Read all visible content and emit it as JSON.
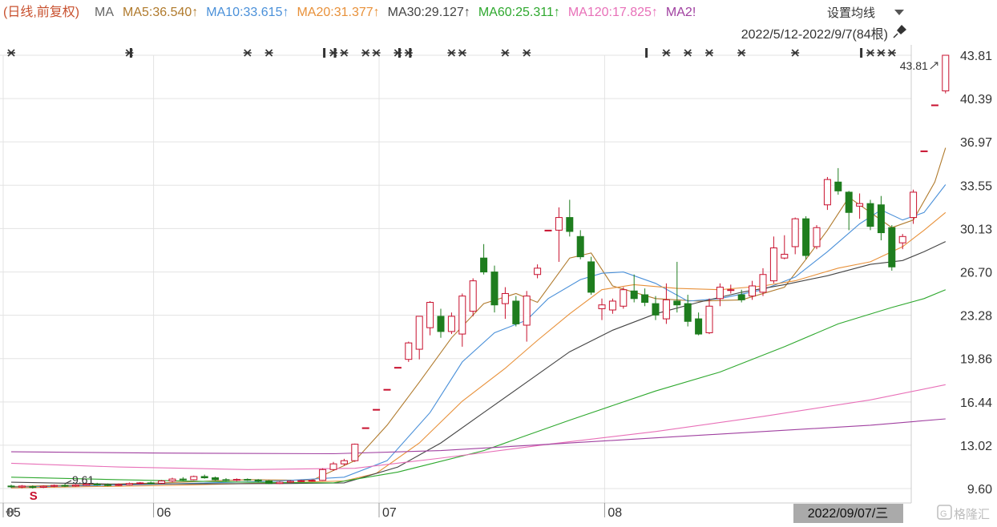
{
  "header": {
    "prefix": "(日线,前复权)",
    "ma_label": "MA",
    "ma_items": [
      {
        "label": "MA5:36.540↑",
        "color": "#b07a2c"
      },
      {
        "label": "MA10:33.615↑",
        "color": "#4a90d9"
      },
      {
        "label": "MA20:31.377↑",
        "color": "#e8913a"
      },
      {
        "label": "MA30:29.127↑",
        "color": "#444444"
      },
      {
        "label": "MA60:25.311↑",
        "color": "#2ea82e"
      },
      {
        "label": "MA120:17.825↑",
        "color": "#e870b8"
      },
      {
        "label": "MA2!",
        "color": "#a040a0"
      }
    ],
    "settings_label": "设置均线",
    "range_label": "2022/5/12-2022/9/7(84根)"
  },
  "footer": {
    "current_date": "2022/09/07/三",
    "watermark": "格隆汇"
  },
  "chart_data": {
    "type": "candlestick",
    "y_ticks": [
      "43.81",
      "40.39",
      "36.97",
      "33.55",
      "30.13",
      "26.70",
      "23.28",
      "19.86",
      "16.44",
      "13.02",
      "9.60"
    ],
    "ylim": [
      9.6,
      43.81
    ],
    "x_ticks": [
      {
        "label": "05",
        "index": 0
      },
      {
        "label": "06",
        "index": 14
      },
      {
        "label": "07",
        "index": 35
      },
      {
        "label": "08",
        "index": 56
      }
    ],
    "annotations": {
      "high_label": "43.81",
      "low_label": "9.61",
      "s_marker": "S"
    },
    "colors": {
      "up": "#c8102e",
      "down": "#1e7d1e",
      "grid": "#e3e3e3"
    },
    "candles": [
      [
        9.8,
        9.75,
        9.9,
        9.65
      ],
      [
        9.72,
        9.8,
        9.88,
        9.62
      ],
      [
        9.75,
        9.7,
        9.85,
        9.6
      ],
      [
        9.7,
        9.78,
        9.86,
        9.64
      ],
      [
        9.78,
        9.85,
        9.92,
        9.7
      ],
      [
        9.85,
        9.8,
        9.96,
        9.72
      ],
      [
        9.8,
        9.88,
        9.95,
        9.74
      ],
      [
        9.86,
        9.95,
        10.05,
        9.8
      ],
      [
        9.95,
        9.9,
        10.05,
        9.82
      ],
      [
        9.9,
        9.85,
        10.0,
        9.78
      ],
      [
        9.85,
        9.92,
        10.0,
        9.8
      ],
      [
        9.9,
        10.0,
        10.08,
        9.85
      ],
      [
        10.0,
        10.05,
        10.12,
        9.92
      ],
      [
        10.05,
        10.02,
        10.15,
        9.95
      ],
      [
        10.02,
        10.2,
        10.28,
        9.98
      ],
      [
        10.2,
        10.35,
        10.45,
        10.12
      ],
      [
        10.35,
        10.3,
        10.5,
        10.22
      ],
      [
        10.3,
        10.55,
        10.62,
        10.25
      ],
      [
        10.55,
        10.45,
        10.7,
        10.38
      ],
      [
        10.45,
        10.3,
        10.55,
        10.22
      ],
      [
        10.3,
        10.25,
        10.42,
        10.18
      ],
      [
        10.25,
        10.32,
        10.4,
        10.18
      ],
      [
        10.32,
        10.28,
        10.4,
        10.2
      ],
      [
        10.28,
        10.2,
        10.35,
        10.1
      ],
      [
        10.2,
        10.0,
        10.26,
        9.95
      ],
      [
        10.0,
        10.1,
        10.18,
        9.95
      ],
      [
        10.1,
        10.18,
        10.25,
        10.05
      ],
      [
        10.18,
        10.22,
        10.3,
        10.12
      ],
      [
        10.22,
        10.25,
        10.32,
        10.15
      ],
      [
        10.25,
        11.1,
        11.2,
        10.22
      ],
      [
        11.1,
        11.55,
        11.7,
        11.0
      ],
      [
        11.55,
        11.8,
        11.95,
        11.4
      ],
      [
        11.8,
        13.1,
        13.15,
        11.7
      ],
      [
        14.4,
        14.4,
        14.4,
        14.4
      ],
      [
        15.85,
        15.85,
        15.85,
        15.85
      ],
      [
        17.43,
        17.43,
        17.43,
        17.43
      ],
      [
        19.17,
        19.17,
        19.17,
        19.17
      ],
      [
        19.8,
        21.1,
        21.2,
        19.6
      ],
      [
        20.6,
        23.2,
        23.2,
        19.8
      ],
      [
        22.3,
        24.3,
        24.4,
        21.7
      ],
      [
        23.2,
        22.0,
        23.8,
        21.5
      ],
      [
        22.0,
        23.2,
        23.5,
        21.8
      ],
      [
        21.8,
        24.8,
        25.0,
        20.8
      ],
      [
        23.6,
        26.0,
        26.2,
        23.2
      ],
      [
        27.8,
        26.7,
        28.9,
        26.5
      ],
      [
        26.7,
        24.1,
        27.2,
        23.5
      ],
      [
        24.2,
        25.0,
        25.5,
        23.0
      ],
      [
        24.4,
        22.6,
        24.8,
        22.4
      ],
      [
        22.5,
        24.8,
        25.2,
        21.2
      ],
      [
        26.5,
        27.0,
        27.3,
        26.2
      ],
      [
        30.0,
        30.0,
        30.0,
        30.0
      ],
      [
        30.0,
        31.0,
        31.8,
        27.5
      ],
      [
        31.0,
        29.9,
        32.4,
        29.5
      ],
      [
        29.5,
        27.9,
        30.0,
        27.7
      ],
      [
        27.5,
        25.1,
        27.9,
        24.9
      ],
      [
        23.8,
        24.1,
        24.6,
        22.9
      ],
      [
        23.7,
        24.4,
        24.6,
        23.4
      ],
      [
        24.0,
        25.3,
        25.5,
        23.8
      ],
      [
        25.2,
        24.6,
        26.5,
        24.3
      ],
      [
        24.9,
        24.3,
        25.4,
        24.0
      ],
      [
        24.2,
        23.3,
        24.8,
        22.9
      ],
      [
        23.0,
        24.5,
        25.8,
        22.6
      ],
      [
        24.4,
        24.1,
        27.5,
        23.5
      ],
      [
        24.2,
        22.8,
        24.9,
        22.4
      ],
      [
        23.0,
        21.8,
        23.5,
        21.7
      ],
      [
        21.9,
        24.0,
        24.6,
        21.8
      ],
      [
        24.6,
        25.5,
        25.8,
        24.0
      ],
      [
        25.3,
        25.3,
        25.7,
        25.0
      ],
      [
        24.9,
        24.5,
        25.3,
        24.3
      ],
      [
        24.8,
        25.6,
        26.0,
        24.5
      ],
      [
        25.1,
        26.5,
        27.0,
        24.8
      ],
      [
        26.0,
        28.6,
        29.5,
        25.8
      ],
      [
        27.8,
        28.1,
        29.6,
        27.7
      ],
      [
        28.7,
        30.9,
        31.0,
        28.1
      ],
      [
        30.9,
        28.0,
        31.1,
        27.7
      ],
      [
        28.7,
        30.2,
        30.4,
        28.5
      ],
      [
        32.0,
        34.0,
        34.2,
        31.6
      ],
      [
        33.8,
        33.1,
        34.9,
        32.8
      ],
      [
        33.0,
        31.4,
        33.1,
        30.0
      ],
      [
        31.9,
        32.1,
        32.9,
        30.9
      ],
      [
        32.1,
        30.3,
        32.4,
        30.0
      ],
      [
        32.0,
        29.8,
        32.7,
        29.2
      ],
      [
        30.2,
        27.1,
        30.4,
        26.8
      ],
      [
        29.0,
        29.5,
        29.7,
        28.5
      ],
      [
        31.0,
        33.0,
        33.2,
        30.5
      ],
      [
        36.26,
        36.26,
        36.26,
        36.26
      ],
      [
        39.89,
        39.89,
        39.89,
        39.89
      ],
      [
        41.0,
        43.81,
        43.81,
        40.8
      ]
    ],
    "ma_series": [
      {
        "name": "MA5",
        "color": "#b07a2c",
        "values": [
          [
            0,
            9.75
          ],
          [
            14,
            10.05
          ],
          [
            22,
            10.3
          ],
          [
            28,
            10.25
          ],
          [
            32,
            11.8
          ],
          [
            35,
            14.6
          ],
          [
            38,
            18.0
          ],
          [
            41,
            21.5
          ],
          [
            44,
            24.2
          ],
          [
            47,
            25.0
          ],
          [
            49,
            24.3
          ],
          [
            52,
            27.8
          ],
          [
            54,
            28.2
          ],
          [
            56,
            25.6
          ],
          [
            60,
            24.6
          ],
          [
            64,
            24.4
          ],
          [
            68,
            24.5
          ],
          [
            72,
            25.5
          ],
          [
            74,
            27.7
          ],
          [
            76,
            30.0
          ],
          [
            78,
            32.6
          ],
          [
            82,
            30.2
          ],
          [
            84,
            30.8
          ],
          [
            86,
            33.8
          ],
          [
            87,
            36.5
          ]
        ]
      },
      {
        "name": "MA10",
        "color": "#4a90d9",
        "values": [
          [
            0,
            9.7
          ],
          [
            14,
            9.95
          ],
          [
            25,
            10.2
          ],
          [
            31,
            10.5
          ],
          [
            35,
            11.8
          ],
          [
            39,
            15.6
          ],
          [
            42,
            19.6
          ],
          [
            45,
            21.9
          ],
          [
            48,
            22.9
          ],
          [
            50,
            24.6
          ],
          [
            53,
            26.1
          ],
          [
            55,
            26.6
          ],
          [
            57,
            26.7
          ],
          [
            60,
            25.8
          ],
          [
            63,
            24.4
          ],
          [
            66,
            24.6
          ],
          [
            70,
            25.3
          ],
          [
            73,
            26.3
          ],
          [
            76,
            28.3
          ],
          [
            79,
            30.5
          ],
          [
            81,
            31.6
          ],
          [
            83,
            30.8
          ],
          [
            85,
            31.4
          ],
          [
            87,
            33.6
          ]
        ]
      },
      {
        "name": "MA20",
        "color": "#e8913a",
        "values": [
          [
            0,
            9.65
          ],
          [
            15,
            9.85
          ],
          [
            27,
            10.1
          ],
          [
            31,
            10.2
          ],
          [
            34,
            10.8
          ],
          [
            38,
            13.2
          ],
          [
            42,
            16.5
          ],
          [
            46,
            19.1
          ],
          [
            49,
            21.3
          ],
          [
            52,
            23.4
          ],
          [
            55,
            25.3
          ],
          [
            58,
            25.7
          ],
          [
            62,
            25.4
          ],
          [
            66,
            25.3
          ],
          [
            70,
            25.6
          ],
          [
            73,
            26.0
          ],
          [
            77,
            27.0
          ],
          [
            80,
            27.5
          ],
          [
            83,
            28.7
          ],
          [
            85,
            30.0
          ],
          [
            87,
            31.4
          ]
        ]
      },
      {
        "name": "MA30",
        "color": "#444444",
        "values": [
          [
            0,
            10.1
          ],
          [
            10,
            9.95
          ],
          [
            26,
            10.0
          ],
          [
            31,
            10.05
          ],
          [
            36,
            11.3
          ],
          [
            40,
            13.2
          ],
          [
            44,
            15.6
          ],
          [
            48,
            18.0
          ],
          [
            52,
            20.4
          ],
          [
            56,
            22.1
          ],
          [
            60,
            23.4
          ],
          [
            64,
            24.3
          ],
          [
            68,
            25.1
          ],
          [
            72,
            25.7
          ],
          [
            76,
            26.4
          ],
          [
            80,
            27.3
          ],
          [
            83,
            27.6
          ],
          [
            85,
            28.3
          ],
          [
            87,
            29.1
          ]
        ]
      },
      {
        "name": "MA60",
        "color": "#2ea82e",
        "values": [
          [
            0,
            10.5
          ],
          [
            10,
            10.3
          ],
          [
            22,
            10.1
          ],
          [
            30,
            10.05
          ],
          [
            36,
            10.9
          ],
          [
            44,
            12.6
          ],
          [
            52,
            15.0
          ],
          [
            60,
            17.3
          ],
          [
            66,
            18.8
          ],
          [
            72,
            20.8
          ],
          [
            77,
            22.6
          ],
          [
            82,
            23.9
          ],
          [
            85,
            24.6
          ],
          [
            87,
            25.3
          ]
        ]
      },
      {
        "name": "MA120",
        "color": "#e870b8",
        "values": [
          [
            0,
            11.6
          ],
          [
            10,
            11.3
          ],
          [
            22,
            11.1
          ],
          [
            32,
            11.2
          ],
          [
            40,
            12.0
          ],
          [
            50,
            13.1
          ],
          [
            60,
            14.1
          ],
          [
            70,
            15.3
          ],
          [
            80,
            16.6
          ],
          [
            87,
            17.8
          ]
        ]
      },
      {
        "name": "MA250",
        "color": "#a040a0",
        "values": [
          [
            0,
            12.5
          ],
          [
            14,
            12.4
          ],
          [
            30,
            12.35
          ],
          [
            40,
            12.6
          ],
          [
            50,
            13.1
          ],
          [
            60,
            13.6
          ],
          [
            70,
            14.1
          ],
          [
            80,
            14.6
          ],
          [
            87,
            15.1
          ]
        ]
      }
    ],
    "markers": {
      "stars": [
        0,
        11,
        22,
        24,
        30,
        31,
        33,
        34,
        36,
        37,
        41,
        42,
        46,
        48,
        61,
        63,
        65,
        68,
        73,
        80,
        81,
        82
      ],
      "bars": [
        11,
        29,
        30,
        36,
        37,
        59,
        79
      ]
    }
  }
}
